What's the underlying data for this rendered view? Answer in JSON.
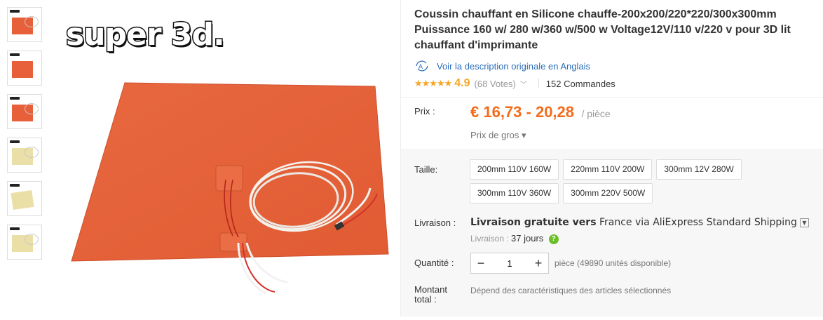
{
  "gallery": {
    "logo_text": "super 3d.",
    "thumbnails": [
      "thumb-1",
      "thumb-2",
      "thumb-3",
      "thumb-4",
      "thumb-5",
      "thumb-6"
    ]
  },
  "product": {
    "title": "Coussin chauffant en Silicone chauffe-200x200/220*220/300x300mm Puissance 160 w/ 280 w/360 w/500 w Voltage12V/110 v/220 v pour 3D lit chauffant d'imprimante",
    "translate_link": "Voir la description originale en Anglais",
    "rating_value": "4.9",
    "votes": "(68 Votes)",
    "orders": "152 Commandes"
  },
  "price": {
    "label": "Prix :",
    "value": "€ 16,73 - 20,28",
    "unit": "/ pièce",
    "wholesale": "Prix de gros ▾"
  },
  "options": {
    "size_label": "Taille:",
    "sizes": [
      "200mm 110V 160W",
      "220mm 110V 200W",
      "300mm 12V 280W",
      "300mm 110V 360W",
      "300mm 220V 500W"
    ],
    "shipping_label": "Livraison :",
    "shipping_free": "Livraison gratuite vers",
    "shipping_rest": " France via AliExpress Standard Shipping",
    "delivery_label": "Livraison :",
    "delivery_days": "37 jours",
    "quantity_label": "Quantité :",
    "quantity_value": "1",
    "quantity_info": "pièce (49890 unités disponible)",
    "total_label_1": "Montant",
    "total_label_2": "total :",
    "total_value": "Dépend des caractéristiques des articles sélectionnés"
  },
  "colors": {
    "price": "#f46b1a",
    "link": "#2a6ebb",
    "star": "#f5a623",
    "pad": "#e8603a"
  }
}
